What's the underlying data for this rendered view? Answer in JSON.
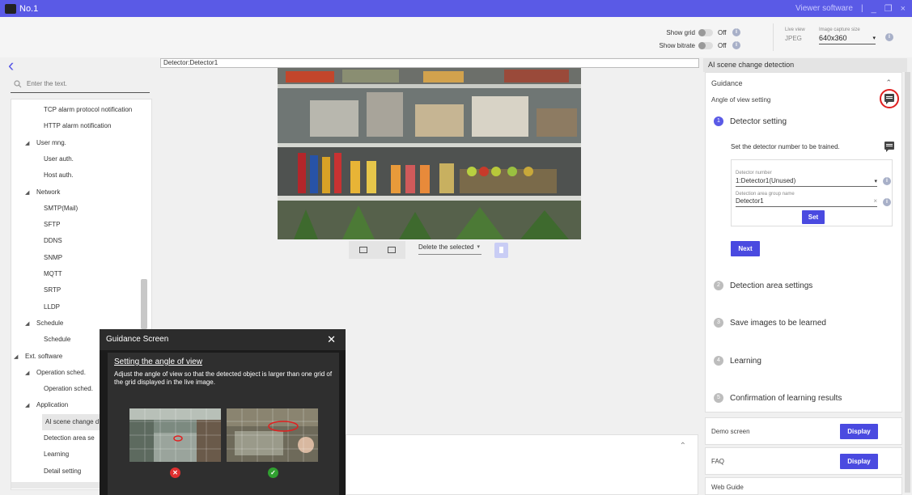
{
  "window": {
    "title": "No.1",
    "app_name": "Viewer software",
    "separator": "|",
    "minimize": "_",
    "restore": "❐",
    "close": "×"
  },
  "toolbar": {
    "show_grid_label": "Show grid",
    "show_grid_value": "Off",
    "show_bitrate_label": "Show bitrate",
    "show_bitrate_value": "Off",
    "live_view_label": "Live view",
    "live_view_value": "JPEG",
    "capture_size_label": "Image capture size",
    "capture_size_value": "640x360",
    "info": "i"
  },
  "search": {
    "placeholder": "Enter the text."
  },
  "tree": {
    "items": [
      {
        "label": "TCP alarm protocol notification",
        "toggle": ""
      },
      {
        "label": "HTTP alarm notification",
        "toggle": ""
      },
      {
        "label": "User mng.",
        "toggle": "◢"
      },
      {
        "label": "User auth.",
        "toggle": ""
      },
      {
        "label": "Host auth.",
        "toggle": ""
      },
      {
        "label": "Network",
        "toggle": "◢"
      },
      {
        "label": "SMTP(Mail)",
        "toggle": ""
      },
      {
        "label": "SFTP",
        "toggle": ""
      },
      {
        "label": "DDNS",
        "toggle": ""
      },
      {
        "label": "SNMP",
        "toggle": ""
      },
      {
        "label": "MQTT",
        "toggle": ""
      },
      {
        "label": "SRTP",
        "toggle": ""
      },
      {
        "label": "LLDP",
        "toggle": ""
      },
      {
        "label": "Schedule",
        "toggle": "◢"
      },
      {
        "label": "Schedule",
        "toggle": ""
      },
      {
        "label": "Ext. software",
        "toggle": "◢"
      },
      {
        "label": "Operation sched.",
        "toggle": "◢"
      },
      {
        "label": "Operation sched.",
        "toggle": ""
      },
      {
        "label": "Application",
        "toggle": "◢"
      },
      {
        "label": "AI scene change d",
        "toggle": ""
      },
      {
        "label": "Detection area se",
        "toggle": ""
      },
      {
        "label": "Learning",
        "toggle": ""
      },
      {
        "label": "Detail setting",
        "toggle": ""
      }
    ]
  },
  "center": {
    "detector_header": "Detector:Detector1",
    "delete_select": "Delete the selected",
    "delete_caret": "▾"
  },
  "right": {
    "header": "AI scene change detection",
    "guidance_title": "Guidance",
    "angle_setting": "Angle of view setting",
    "steps": [
      {
        "num": "1",
        "label": "Detector setting"
      },
      {
        "num": "2",
        "label": "Detection area settings"
      },
      {
        "num": "3",
        "label": "Save images to be learned"
      },
      {
        "num": "4",
        "label": "Learning"
      },
      {
        "num": "5",
        "label": "Confirmation of learning results"
      }
    ],
    "step1_desc": "Set the detector number to be trained.",
    "detector_number_label": "Detector number",
    "detector_number_value": "1:Detector1(Unused)",
    "group_name_label": "Detection area group name",
    "group_name_value": "Detector1",
    "set_button": "Set",
    "next_button": "Next",
    "demo_label": "Demo screen",
    "demo_button": "Display",
    "faq_label": "FAQ",
    "faq_button": "Display",
    "web_guide_label": "Web Guide"
  },
  "popup": {
    "title": "Guidance Screen",
    "close": "✕",
    "subtitle": "Setting the angle of view",
    "text": "Adjust the angle of view so that the detected object is larger than one grid of the grid displayed in the live image.",
    "bad_mark": "✕",
    "good_mark": "✓"
  },
  "colors": {
    "accent": "#5a5ae6",
    "button": "#4a4ae0",
    "highlight": "#e02020",
    "bad": "#e03030",
    "good": "#30a030"
  }
}
